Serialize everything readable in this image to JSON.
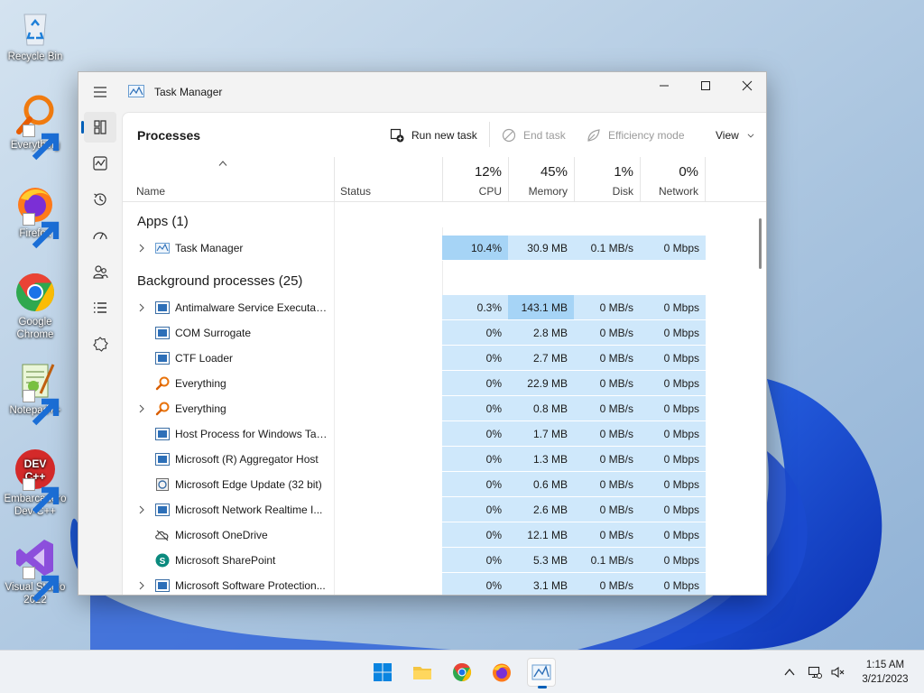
{
  "desktop": {
    "icons": [
      {
        "label": "Recycle Bin"
      },
      {
        "label": "Everything"
      },
      {
        "label": "Firefox"
      },
      {
        "label": "Google Chrome"
      },
      {
        "label": "Notepad++"
      },
      {
        "label": "Embarcadero Dev-C++"
      },
      {
        "label": "Visual Studio 2022"
      }
    ]
  },
  "window": {
    "title": "Task Manager",
    "page_title": "Processes",
    "commands": {
      "run_new_task": "Run new task",
      "end_task": "End task",
      "efficiency_mode": "Efficiency mode",
      "view": "View"
    },
    "columns": {
      "name": "Name",
      "status": "Status",
      "cpu": {
        "percent": "12%",
        "label": "CPU"
      },
      "memory": {
        "percent": "45%",
        "label": "Memory"
      },
      "disk": {
        "percent": "1%",
        "label": "Disk"
      },
      "network": {
        "percent": "0%",
        "label": "Network"
      }
    },
    "groups": {
      "apps": "Apps (1)",
      "background": "Background processes (25)"
    },
    "apps": [
      {
        "name": "Task Manager",
        "cpu": "10.4%",
        "memory": "30.9 MB",
        "disk": "0.1 MB/s",
        "network": "0 Mbps"
      }
    ],
    "background": [
      {
        "name": "Antimalware Service Executable",
        "cpu": "0.3%",
        "memory": "143.1 MB",
        "disk": "0 MB/s",
        "network": "0 Mbps"
      },
      {
        "name": "COM Surrogate",
        "cpu": "0%",
        "memory": "2.8 MB",
        "disk": "0 MB/s",
        "network": "0 Mbps"
      },
      {
        "name": "CTF Loader",
        "cpu": "0%",
        "memory": "2.7 MB",
        "disk": "0 MB/s",
        "network": "0 Mbps"
      },
      {
        "name": "Everything",
        "cpu": "0%",
        "memory": "22.9 MB",
        "disk": "0 MB/s",
        "network": "0 Mbps"
      },
      {
        "name": "Everything",
        "cpu": "0%",
        "memory": "0.8 MB",
        "disk": "0 MB/s",
        "network": "0 Mbps"
      },
      {
        "name": "Host Process for Windows Tasks",
        "cpu": "0%",
        "memory": "1.7 MB",
        "disk": "0 MB/s",
        "network": "0 Mbps"
      },
      {
        "name": "Microsoft (R) Aggregator Host",
        "cpu": "0%",
        "memory": "1.3 MB",
        "disk": "0 MB/s",
        "network": "0 Mbps"
      },
      {
        "name": "Microsoft Edge Update (32 bit)",
        "cpu": "0%",
        "memory": "0.6 MB",
        "disk": "0 MB/s",
        "network": "0 Mbps"
      },
      {
        "name": "Microsoft Network Realtime I...",
        "cpu": "0%",
        "memory": "2.6 MB",
        "disk": "0 MB/s",
        "network": "0 Mbps"
      },
      {
        "name": "Microsoft OneDrive",
        "cpu": "0%",
        "memory": "12.1 MB",
        "disk": "0 MB/s",
        "network": "0 Mbps"
      },
      {
        "name": "Microsoft SharePoint",
        "cpu": "0%",
        "memory": "5.3 MB",
        "disk": "0.1 MB/s",
        "network": "0 Mbps"
      },
      {
        "name": "Microsoft Software Protection...",
        "cpu": "0%",
        "memory": "3.1 MB",
        "disk": "0 MB/s",
        "network": "0 Mbps"
      }
    ]
  },
  "taskbar": {
    "time": "1:15 AM",
    "date": "3/21/2023"
  },
  "colors": {
    "accent": "#005fb8",
    "cell_bg": "#cfe8fb",
    "cell_hot": "#a6d4f6"
  }
}
